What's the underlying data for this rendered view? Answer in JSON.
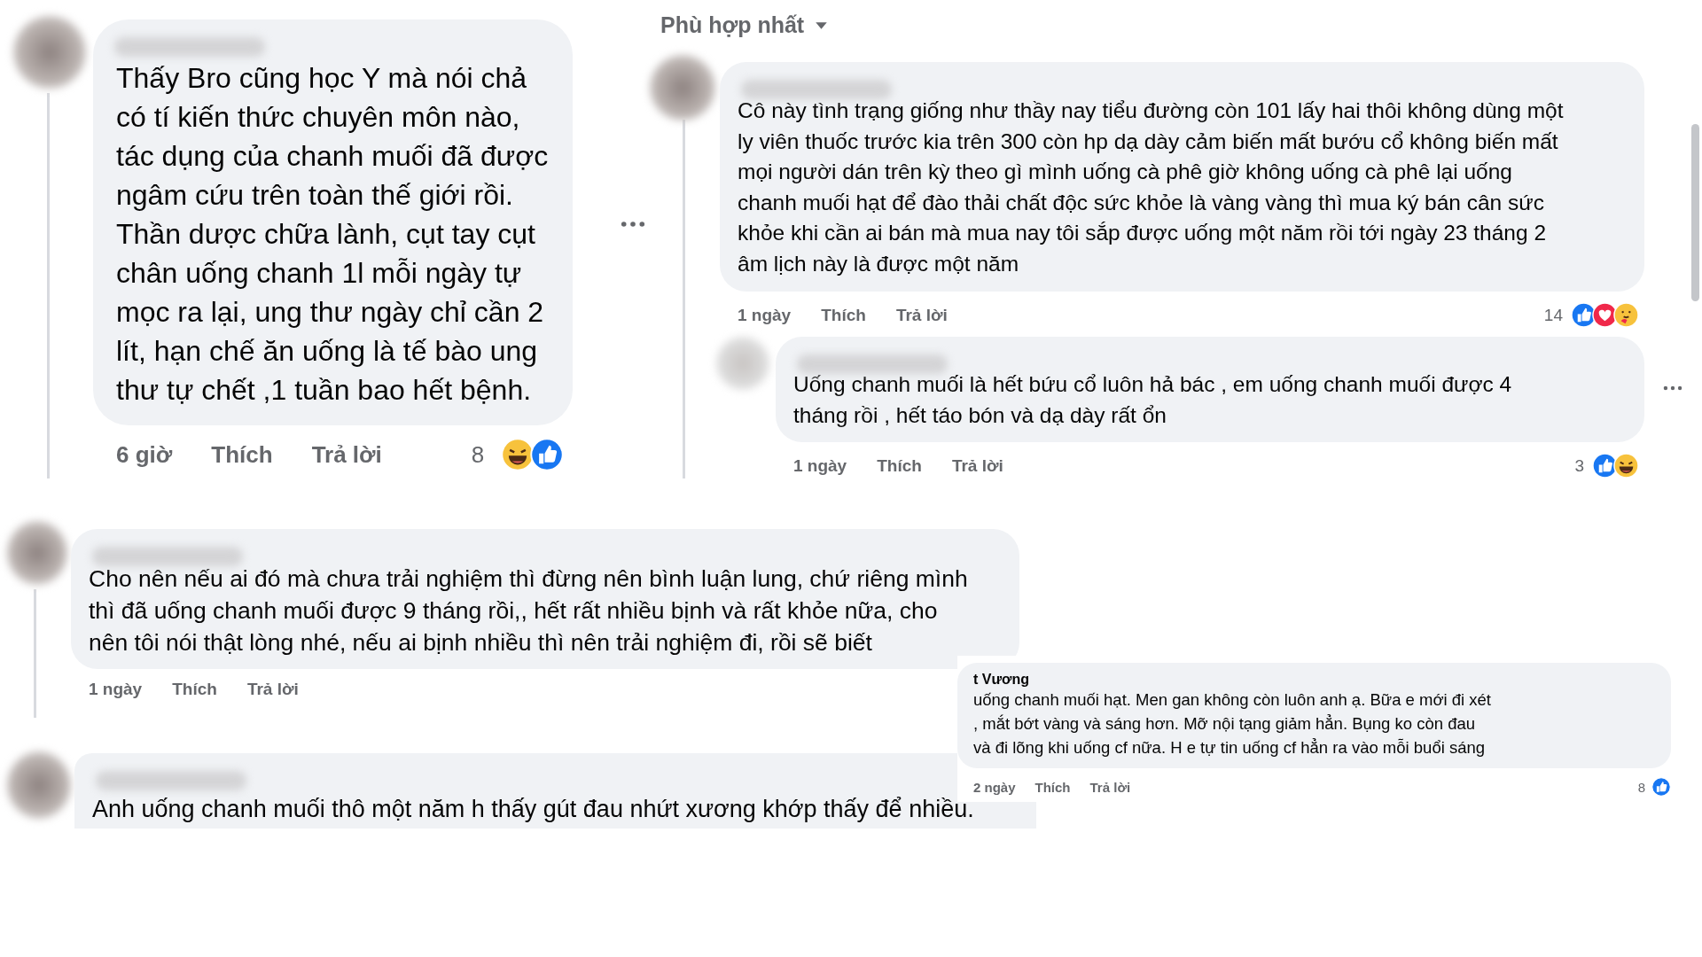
{
  "sort_label": "Phù hợp nhất",
  "comments": [
    {
      "text": "Thấy Bro cũng học Y mà nói chả\ncó tí kiến thức chuyên môn nào,\ntác dụng của chanh muối đã được\nngâm cứu trên toàn thế giới rồi.\nThần dược chữa lành, cụt tay cụt\nchân uống chanh 1l mỗi ngày tự\nmọc ra lại, ung thư ngày chỉ cần 2\nlít, hạn chế ăn uống là tế bào ung\nthư tự chết ,1 tuần bao hết bệnh.",
      "time": "6 giờ",
      "like": "Thích",
      "reply": "Trả lời",
      "reaction_count": "8",
      "reactions": [
        {
          "kind": "haha"
        },
        {
          "kind": "like"
        }
      ]
    },
    {
      "text": "Cô này tình trạng giống như thầy nay tiểu đường còn 101 lấy hai thôi không dùng một\nly viên thuốc trước kia trên 300 còn hp dạ dày cảm biến mất bướu cổ không biến mất\nmọi người dán trên kỳ theo gì mình uống cà phê giờ không uống cà phê lại uống\nchanh muối hạt để đào thải chất độc sức khỏe là vàng vàng thì mua ký bán cân sức\nkhỏe khi cần ai bán mà mua nay tôi sắp được uống một năm rồi tới ngày 23 tháng 2\nâm lịch này là được một năm",
      "time": "1 ngày",
      "like": "Thích",
      "reply": "Trả lời",
      "reaction_count": "14",
      "reactions": [
        {
          "kind": "like"
        },
        {
          "kind": "love"
        },
        {
          "kind": "care"
        }
      ]
    },
    {
      "text": "Uống chanh muối là hết bứu cổ luôn hả bác , em uống chanh muối được 4\ntháng rồi , hết táo bón và dạ dày rất ổn",
      "time": "1 ngày",
      "like": "Thích",
      "reply": "Trả lời",
      "reaction_count": "3",
      "reactions": [
        {
          "kind": "like"
        },
        {
          "kind": "haha"
        }
      ]
    },
    {
      "text": "Cho nên nếu ai đó mà chưa trải nghiệm thì đừng nên bình luận lung, chứ riêng mình\nthì đã uống chanh muối được 9 tháng rồi,, hết rất nhiều bịnh và rất khỏe nữa, cho\nnên tôi nói thật lòng nhé, nếu ai bịnh nhiều thì nên trải nghiệm đi, rồi sẽ biết",
      "time": "1 ngày",
      "like": "Thích",
      "reply": "Trả lời"
    },
    {
      "text": "Anh uống chanh muối thô một năm h thấy gút đau nhứt xương khớp thấy để nhiều."
    },
    {
      "author": "t Vương",
      "text": "uống chanh muối hạt. Men gan không còn luôn anh ạ. Bữa e mới đi xét\n, mắt bớt vàng và sáng hơn. Mỡ nội tạng giảm hẳn. Bụng ko còn đau\nvà đi lõng khi uống cf nữa. H e tự tin uống cf hẳn ra vào mỗi buổi sáng",
      "time": "2 ngày",
      "like": "Thích",
      "reply": "Trả lời",
      "reaction_count": "8",
      "reactions": [
        {
          "kind": "like"
        }
      ]
    }
  ]
}
